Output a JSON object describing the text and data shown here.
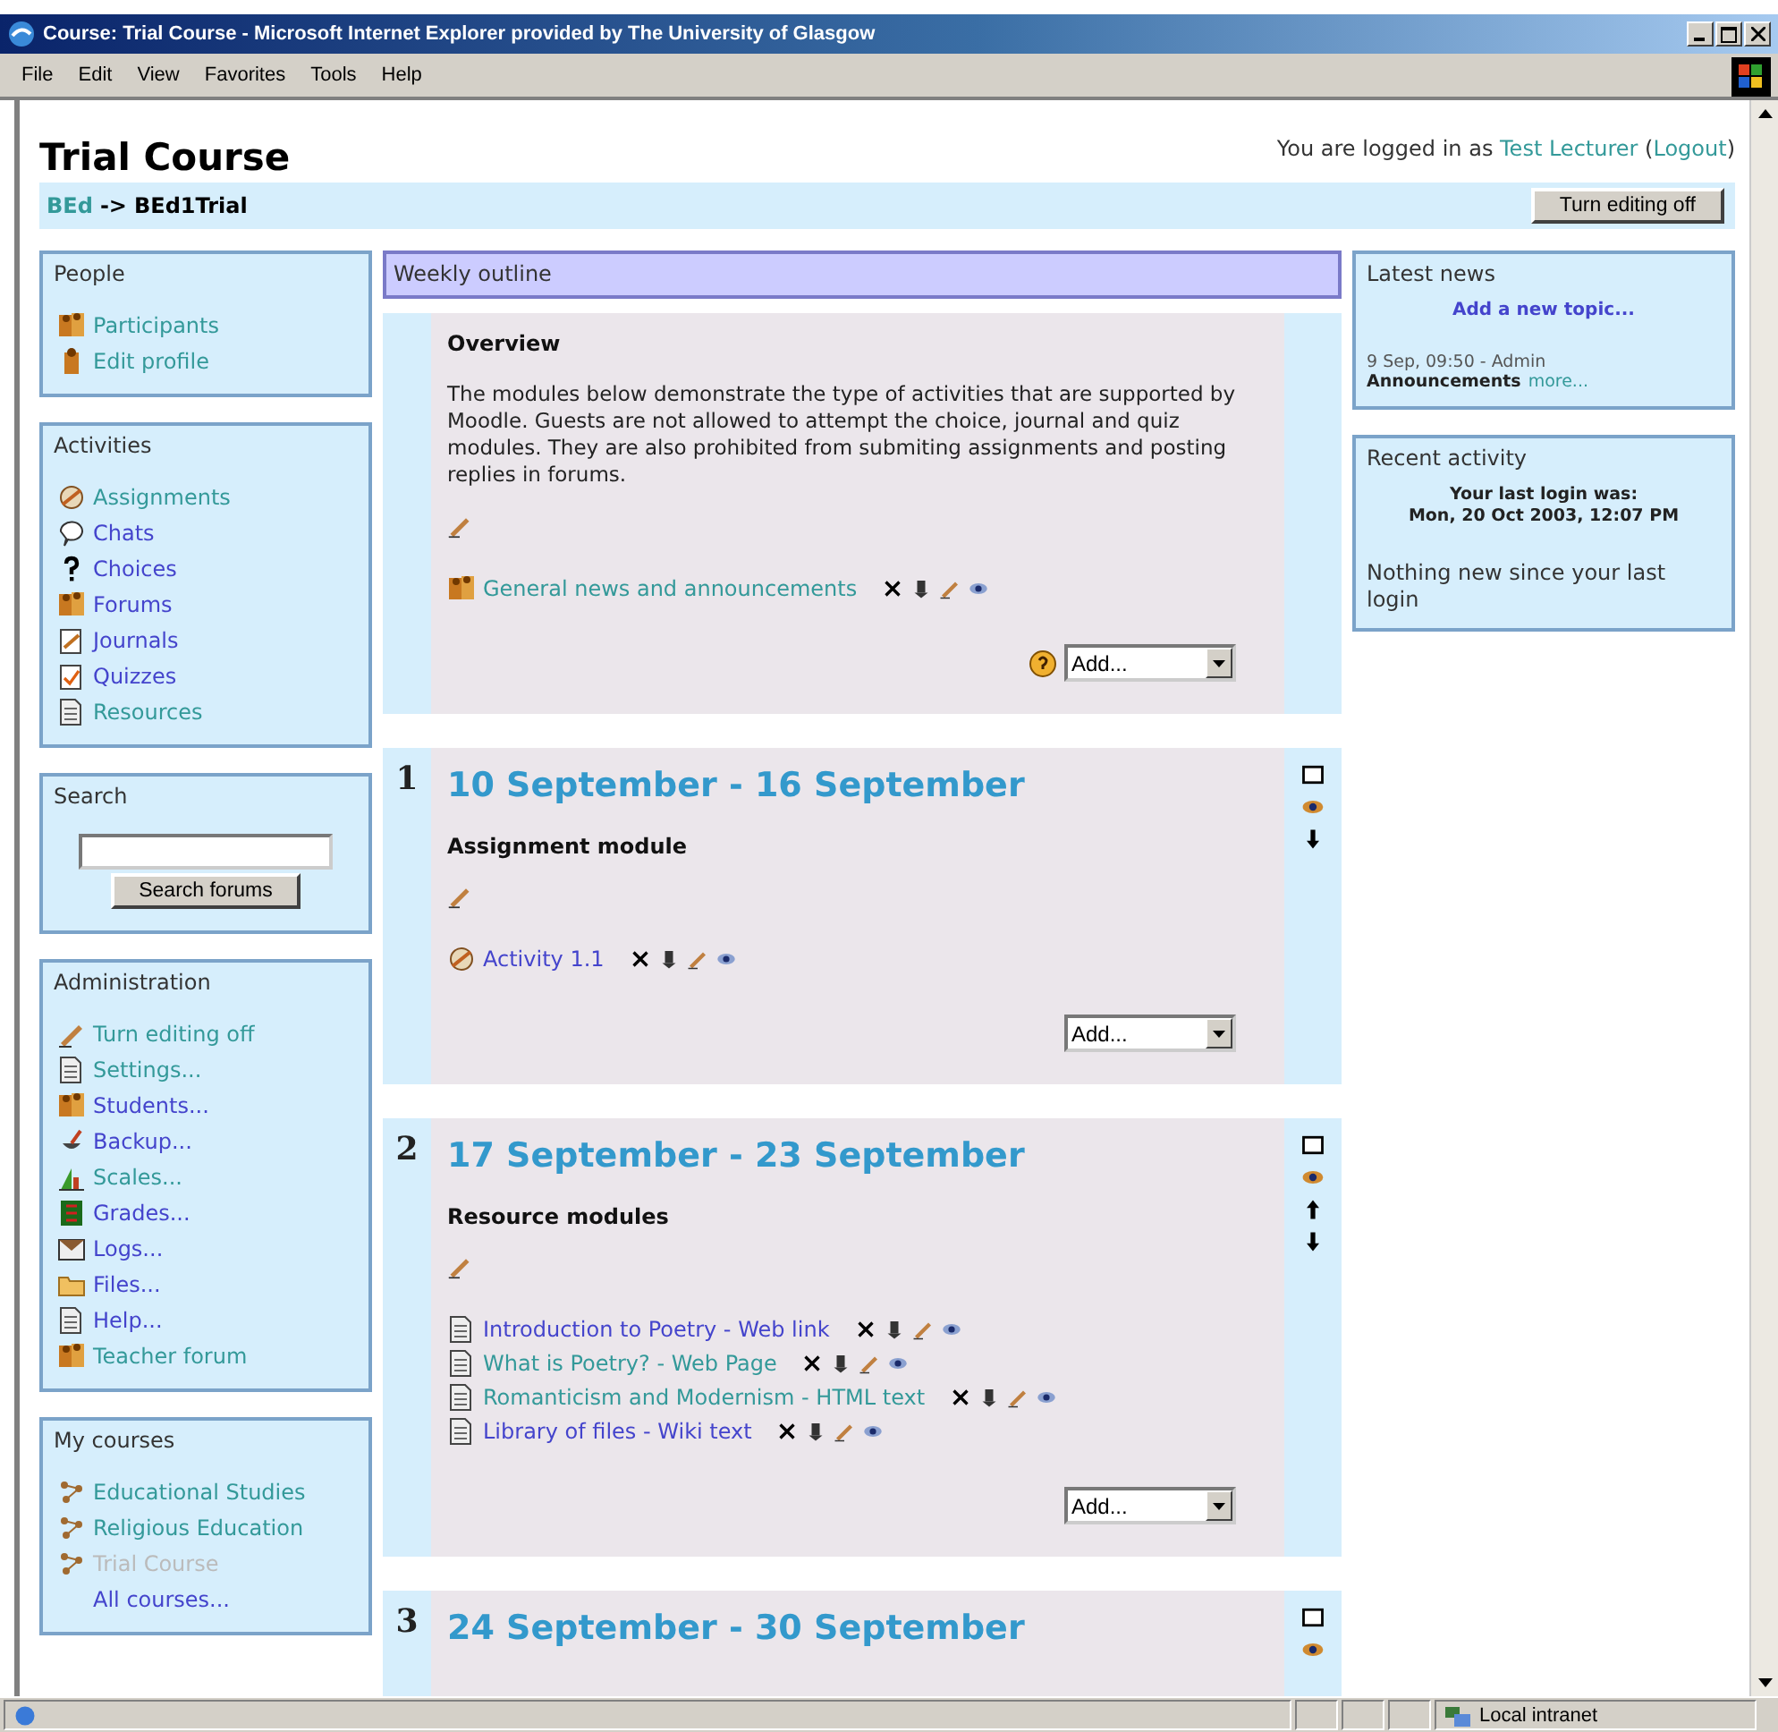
{
  "window": {
    "title": "Course: Trial Course - Microsoft Internet Explorer provided by The University of Glasgow"
  },
  "menu": [
    "File",
    "Edit",
    "View",
    "Favorites",
    "Tools",
    "Help"
  ],
  "page": {
    "title": "Trial Course",
    "login": [
      {
        "text": "You are logged in as ",
        "link": false
      },
      {
        "text": "Test Lecturer",
        "link": true
      },
      {
        "text": " (",
        "link": false
      },
      {
        "text": "Logout",
        "link": true
      },
      {
        "text": ")",
        "link": false
      }
    ],
    "breadcrumb": [
      {
        "text": "BEd",
        "link": true
      },
      {
        "text": "->",
        "link": false
      },
      {
        "text": "BEd1Trial",
        "link": false
      }
    ],
    "edit_button": "Turn editing off"
  },
  "left_blocks": [
    {
      "kind": "links",
      "title": "People",
      "items": [
        {
          "label": "Participants",
          "visited": false,
          "disabled": false
        },
        {
          "label": "Edit profile",
          "visited": false,
          "disabled": false
        }
      ]
    },
    {
      "kind": "links",
      "title": "Activities",
      "items": [
        {
          "label": "Assignments",
          "visited": false,
          "disabled": false
        },
        {
          "label": "Chats",
          "visited": true,
          "disabled": false
        },
        {
          "label": "Choices",
          "visited": true,
          "disabled": false
        },
        {
          "label": "Forums",
          "visited": true,
          "disabled": false
        },
        {
          "label": "Journals",
          "visited": true,
          "disabled": false
        },
        {
          "label": "Quizzes",
          "visited": true,
          "disabled": false
        },
        {
          "label": "Resources",
          "visited": false,
          "disabled": false
        }
      ]
    },
    {
      "kind": "search",
      "title": "Search",
      "button": "Search forums"
    },
    {
      "kind": "links",
      "title": "Administration",
      "items": [
        {
          "label": "Turn editing off",
          "visited": false,
          "disabled": false
        },
        {
          "label": "Settings...",
          "visited": false,
          "disabled": false
        },
        {
          "label": "Students...",
          "visited": true,
          "disabled": false
        },
        {
          "label": "Backup...",
          "visited": true,
          "disabled": false
        },
        {
          "label": "Scales...",
          "visited": false,
          "disabled": false
        },
        {
          "label": "Grades...",
          "visited": true,
          "disabled": false
        },
        {
          "label": "Logs...",
          "visited": true,
          "disabled": false
        },
        {
          "label": "Files...",
          "visited": true,
          "disabled": false
        },
        {
          "label": "Help...",
          "visited": true,
          "disabled": false
        },
        {
          "label": "Teacher forum",
          "visited": false,
          "disabled": false
        }
      ]
    },
    {
      "kind": "links",
      "title": "My courses",
      "items": [
        {
          "label": "Educational Studies",
          "visited": false,
          "disabled": false
        },
        {
          "label": "Religious Education",
          "visited": false,
          "disabled": false
        },
        {
          "label": "Trial Course",
          "visited": false,
          "disabled": true
        },
        {
          "label": "All courses...",
          "visited": true,
          "disabled": false
        }
      ]
    }
  ],
  "outline": {
    "title": "Weekly outline",
    "sections": [
      {
        "summary": "Overview",
        "text": "The modules below demonstrate the type of activities that are supported by Moodle. Guests are not allowed to attempt the choice, journal and quiz modules. They are also prohibited from submiting assignments and posting replies in forums.",
        "modules": [
          {
            "label": "General news and announcements",
            "visited": false
          }
        ],
        "help": true,
        "add": "Add..."
      },
      {
        "number": "1",
        "heading": "10 September - 16 September",
        "summary": "Assignment module",
        "modules": [
          {
            "label": "Activity 1.1",
            "visited": true
          }
        ],
        "add": "Add...",
        "controls": [
          {
            "kind": "highlight"
          },
          {
            "kind": "hide"
          },
          {
            "kind": "down"
          }
        ]
      },
      {
        "number": "2",
        "heading": "17 September - 23 September",
        "summary": "Resource modules",
        "modules": [
          {
            "label": "Introduction to Poetry - Web link",
            "visited": true
          },
          {
            "label": "What is Poetry? - Web Page",
            "visited": false
          },
          {
            "label": "Romanticism and Modernism - HTML text",
            "visited": false
          },
          {
            "label": "Library of files - Wiki text",
            "visited": true
          }
        ],
        "add": "Add...",
        "controls": [
          {
            "kind": "highlight"
          },
          {
            "kind": "hide"
          },
          {
            "kind": "up"
          },
          {
            "kind": "down"
          }
        ]
      },
      {
        "number": "3",
        "heading": "24 September - 30 September",
        "controls": [
          {
            "kind": "highlight"
          },
          {
            "kind": "hide"
          }
        ]
      }
    ]
  },
  "right_blocks": [
    {
      "kind": "news",
      "title": "Latest news",
      "link": "Add a new topic...",
      "meta": "9 Sep, 09:50 - Admin",
      "line": [
        {
          "text": "Announcements",
          "link": false
        },
        {
          "text": "more...",
          "link": true
        }
      ]
    },
    {
      "kind": "recent",
      "title": "Recent activity",
      "lines": [
        "Your last login was:",
        "Mon, 20 Oct 2003, 12:07 PM"
      ],
      "note": "Nothing new since your last login"
    }
  ],
  "status_bar": {
    "zone": "Local intranet"
  }
}
